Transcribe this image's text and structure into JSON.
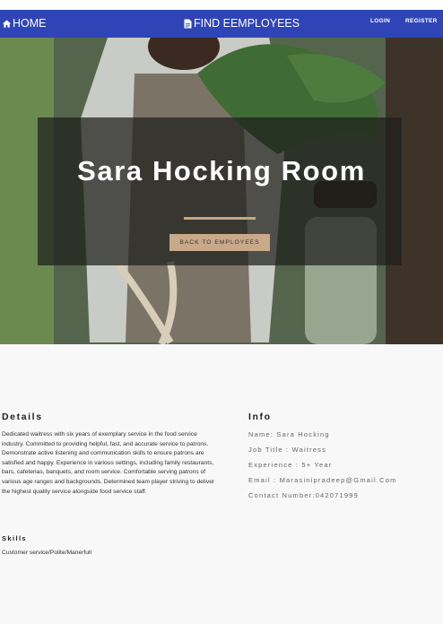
{
  "nav": {
    "home_label": "HOME",
    "find_label": "FIND EEMPLOYEES",
    "login_label": "LOGIN",
    "register_label": "REGISTER",
    "home_icon": "home-icon",
    "find_icon": "document-icon",
    "bar_color": "#2f45b7"
  },
  "hero": {
    "title": "Sara Hocking Room",
    "back_button_label": "BACK TO EMPLOYEES",
    "accent_color": "#c6a784"
  },
  "details": {
    "heading": "Details",
    "text": "Dedicated waitress with six years of exemplary service in the food service industry. Committed to providing helpful, fast, and accurate service to patrons. Demonstrate active listening and communication skills to ensure patrons are satisfied and happy. Experience in various settings, including family restaurants, bars, cafeterias, banquets, and room service. Comfortable serving patrons of various age ranges and backgrounds. Determined team player striving to deliver the highest quality service alongside food service staff."
  },
  "info": {
    "heading": "Info",
    "name": "Name: Sara Hocking",
    "job_title": "Job Title : Waitress",
    "experience": "Experience : 5+ Year",
    "email": "Email : Marasinipradeep@Gmail.Com",
    "contact": "Contact Number:042071999"
  },
  "skills": {
    "heading": "Skills",
    "text": "Customer service/Polite/Manerfull"
  }
}
